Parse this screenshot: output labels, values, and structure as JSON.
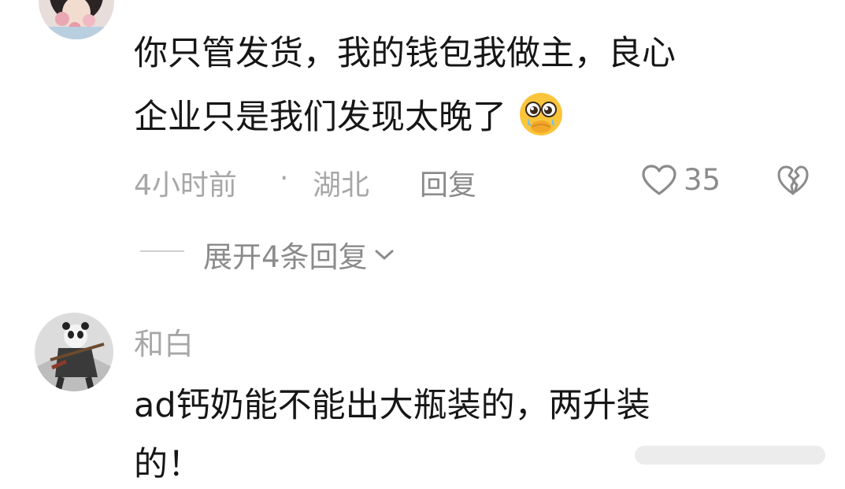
{
  "comment1": {
    "author": "",
    "text_line1": "你只管发货，我的钱包我做主，良心",
    "text_line2": "企业只是我们发现太晚了",
    "emoji": "pleading-face",
    "time": "4小时前",
    "separator": "·",
    "location": "湖北",
    "reply_label": "回复",
    "like_count": "35",
    "expand_replies_label": "展开4条回复"
  },
  "comment2": {
    "author": "和白",
    "text_line1": "ad钙奶能不能出大瓶装的，两升装",
    "text_line2": "的！"
  },
  "colors": {
    "text": "#161616",
    "meta": "#a7a7a7",
    "emoji": "#fbc53b"
  }
}
